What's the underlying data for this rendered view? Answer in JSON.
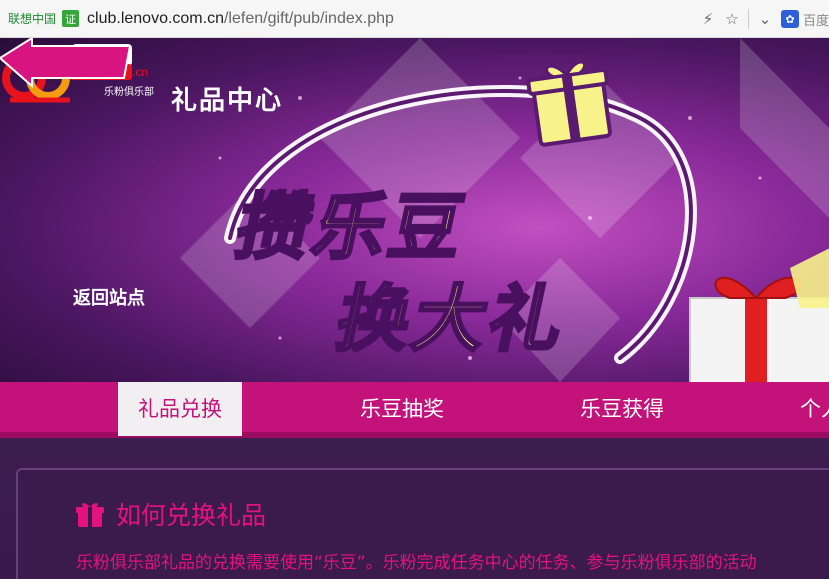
{
  "browser": {
    "site_identity": "联想中国",
    "cert_badge": "证",
    "url_host": "club.lenovo.com.cn",
    "url_path": "/lefen/gift/pub/index.php",
    "search_engine": "百度"
  },
  "banner": {
    "logo_text": "lefen.cn",
    "logo_subtext": "乐粉俱乐部",
    "section_title": "礼品中心",
    "slogan_line1": "攒乐豆",
    "slogan_line2": "换大礼",
    "back_button": "返回站点"
  },
  "nav": {
    "items": [
      {
        "label": "礼品兑换",
        "active": true
      },
      {
        "label": "乐豆抽奖",
        "active": false
      },
      {
        "label": "乐豆获得",
        "active": false
      },
      {
        "label": "个人",
        "active": false
      }
    ]
  },
  "content": {
    "heading": "如何兑换礼品",
    "description": "乐粉俱乐部礼品的兑换需要使用“乐豆”。乐粉完成任务中心的任务、参与乐粉俱乐部的活动"
  },
  "colors": {
    "nav_bg": "#c3127a",
    "accent_pink": "#e4127f",
    "slogan_yellow": "#f8f28a"
  }
}
